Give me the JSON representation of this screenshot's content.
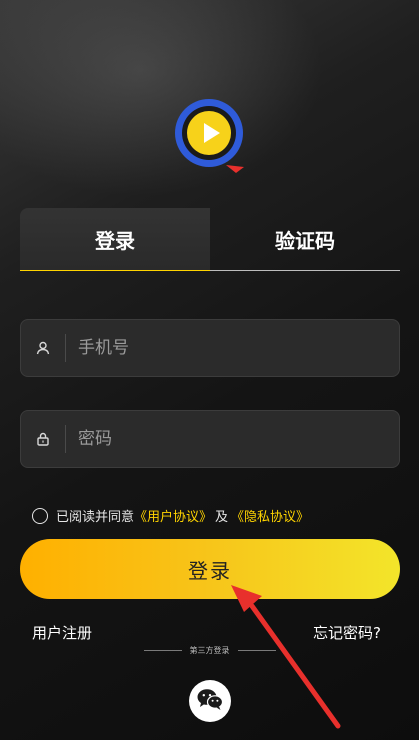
{
  "tabs": {
    "login_label": "登录",
    "code_label": "验证码"
  },
  "form": {
    "phone_placeholder": "手机号",
    "password_placeholder": "密码"
  },
  "agreement": {
    "prefix": "已阅读并同意",
    "user_agreement": "《用户协议》",
    "and": "及",
    "privacy_policy": "《隐私协议》"
  },
  "buttons": {
    "login": "登录",
    "register": "用户注册",
    "forgot": "忘记密码?"
  },
  "third_party": {
    "label": "第三方登录"
  },
  "colors": {
    "accent": "#ffd400",
    "button_gradient_start": "#ffb000",
    "button_gradient_end": "#f3e52a",
    "annotation_arrow": "#e8302c"
  },
  "icons": {
    "logo": "play-search-logo",
    "phone_field": "user-icon",
    "password_field": "lock-icon",
    "third_party": "wechat-icon"
  }
}
